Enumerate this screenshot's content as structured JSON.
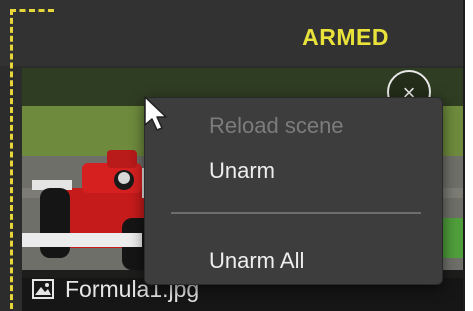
{
  "header": {
    "status": "ARMED"
  },
  "thumbnail": {
    "filename": "Formula1.jpg",
    "close_icon": "×"
  },
  "context_menu": {
    "items": [
      {
        "label": "Reload scene",
        "enabled": false
      },
      {
        "label": "Unarm",
        "enabled": true
      },
      {
        "label": "Unarm All",
        "enabled": true
      }
    ]
  },
  "colors": {
    "armed": "#e8e23a",
    "selection_dash": "#e8d53a"
  }
}
